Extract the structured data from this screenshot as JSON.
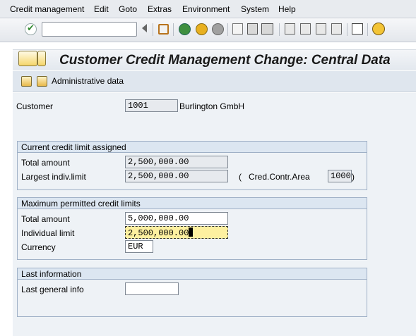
{
  "menu": {
    "items": [
      "Credit management",
      "Edit",
      "Goto",
      "Extras",
      "Environment",
      "System",
      "Help"
    ]
  },
  "toolbar": {
    "command_value": "",
    "icons": [
      "enter-icon",
      "back-nav-icon",
      "save-icon",
      "back-icon",
      "exit-icon",
      "cancel-icon",
      "print-icon",
      "find-icon",
      "find-next-icon",
      "first-page-icon",
      "prev-page-icon",
      "next-page-icon",
      "last-page-icon",
      "layout-icon",
      "help-icon"
    ]
  },
  "header": {
    "title": "Customer Credit Management Change: Central Data"
  },
  "apptoolbar": {
    "admin_label": "Administrative data"
  },
  "customer": {
    "label": "Customer",
    "number": "1001",
    "name": "Burlington GmbH"
  },
  "current_limit": {
    "heading": "Current credit limit assigned",
    "total_label": "Total amount",
    "total_value": "2,500,000.00",
    "largest_label": "Largest indiv.limit",
    "largest_value": "2,500,000.00",
    "paren_open": "(",
    "area_label": "Cred.Contr.Area",
    "area_value": "1000",
    "paren_close": ")"
  },
  "max_limits": {
    "heading": "Maximum permitted credit limits",
    "total_label": "Total amount",
    "total_value": "5,000,000.00",
    "indiv_label": "Individual limit",
    "indiv_value": "2,500,000.00",
    "currency_label": "Currency",
    "currency_value": "EUR"
  },
  "last_info": {
    "heading": "Last information",
    "general_label": "Last general info",
    "general_value": ""
  }
}
